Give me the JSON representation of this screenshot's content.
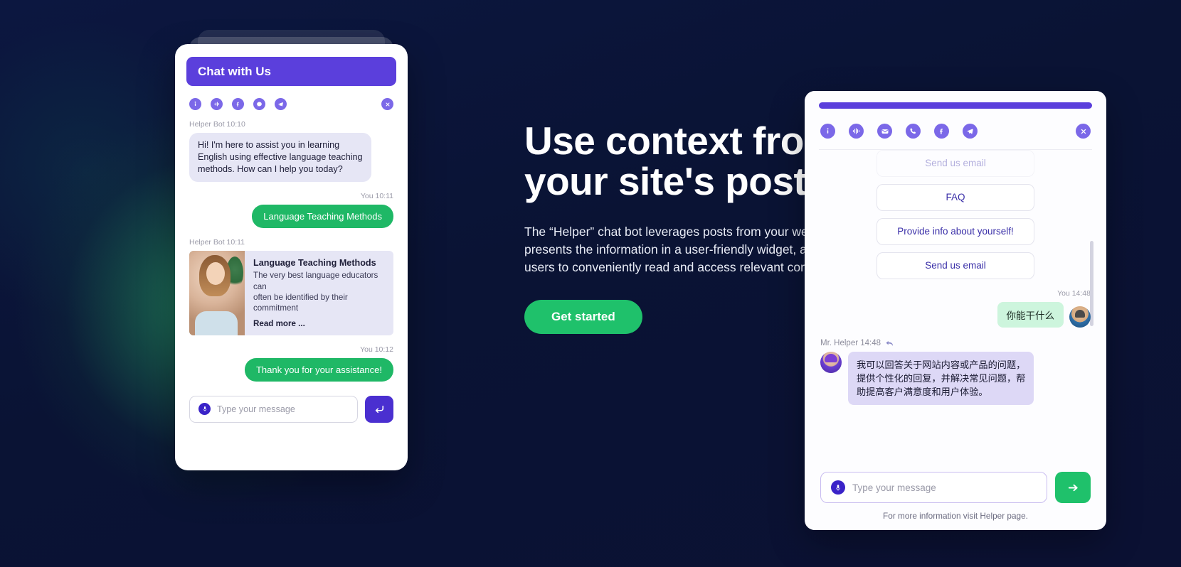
{
  "theme": {
    "background_navy": "#0b1436",
    "glow_green": "#238c5f",
    "accent_purple": "#5b3fdc",
    "accent_green": "#1fc16b",
    "bot_bubble": "#e6e6f5",
    "user_bubble_green": "#1fb866"
  },
  "hero": {
    "title": "Use context from\nyour site's posts",
    "body": "The “Helper” chat bot leverages posts from your website and\npresents the information in a user-friendly widget, allowing\nusers to conveniently read and access relevant content.",
    "cta_label": "Get started"
  },
  "left_widget": {
    "header_title": "Chat with Us",
    "icons": [
      {
        "name": "info-icon",
        "glyph": "i"
      },
      {
        "name": "audio-wave-icon",
        "glyph": "audio"
      },
      {
        "name": "facebook-icon",
        "glyph": "f"
      },
      {
        "name": "messenger-icon",
        "glyph": "chat"
      },
      {
        "name": "telegram-icon",
        "glyph": "send"
      }
    ],
    "close_label": "close-icon",
    "messages": [
      {
        "sender": "Helper Bot",
        "time": "10:10",
        "meta": "Helper Bot 10:10",
        "type": "bot-text",
        "text": "Hi! I'm here to assist you in learning\nEnglish using effective language teaching\nmethods. How can I help you today?"
      },
      {
        "sender": "You",
        "time": "10:11",
        "meta": "You 10:11",
        "type": "user-text",
        "text": "Language Teaching Methods"
      },
      {
        "sender": "Helper Bot",
        "time": "10:11",
        "meta": "Helper Bot 10:11",
        "type": "bot-card",
        "card_title": "Language Teaching Methods",
        "card_text": "The very best language educators can\noften be identified by their commitment",
        "card_readmore": "Read more ..."
      },
      {
        "sender": "You",
        "time": "10:12",
        "meta": "You 10:12",
        "type": "user-text",
        "text": "Thank you for your assistance!"
      }
    ],
    "input_placeholder": "Type your message",
    "input_value": "",
    "send_label": "send-icon"
  },
  "right_widget": {
    "icons": [
      {
        "name": "info-icon",
        "glyph": "i"
      },
      {
        "name": "audio-wave-icon",
        "glyph": "audio"
      },
      {
        "name": "email-icon",
        "glyph": "mail"
      },
      {
        "name": "phone-icon",
        "glyph": "phone"
      },
      {
        "name": "facebook-icon",
        "glyph": "f"
      },
      {
        "name": "telegram-icon",
        "glyph": "send"
      }
    ],
    "close_label": "close-icon",
    "quick_replies": [
      "Send us email",
      "FAQ",
      "Provide info about yourself!",
      "Send us email"
    ],
    "user_message": {
      "meta": "You  14:48",
      "text": "你能干什么"
    },
    "bot_message": {
      "meta": "Mr. Helper 14:48",
      "text": "我可以回答关于网站内容或产品的问题，\n提供个性化的回复，并解决常见问题，帮\n助提高客户满意度和用户体验。"
    },
    "input_placeholder": "Type your message",
    "input_value": "",
    "send_label": "send-arrow-icon",
    "footer": "For more information visit Helper page."
  }
}
